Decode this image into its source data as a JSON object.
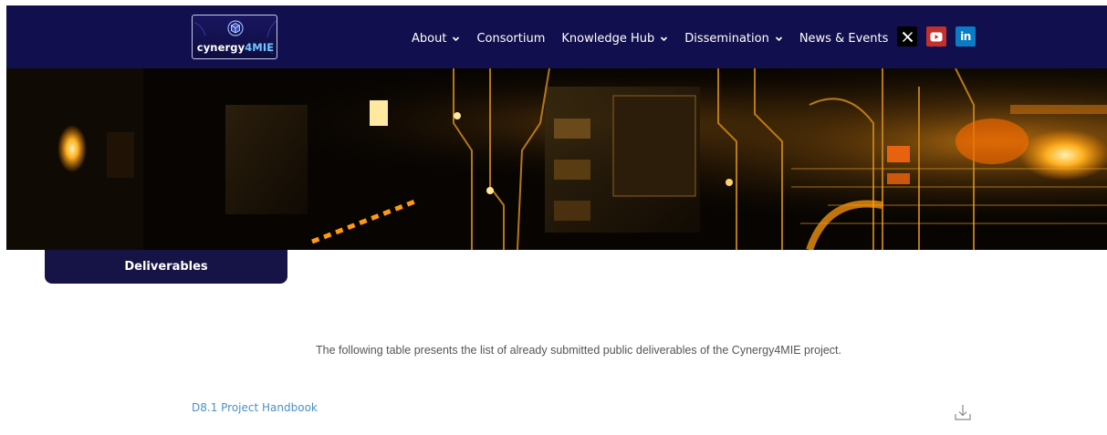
{
  "logo": {
    "text_main": "cynergy",
    "text_accent": "4MIE"
  },
  "nav": {
    "items": [
      {
        "label": "About",
        "has_dropdown": true
      },
      {
        "label": "Consortium",
        "has_dropdown": false
      },
      {
        "label": "Knowledge Hub",
        "has_dropdown": true
      },
      {
        "label": "Dissemination",
        "has_dropdown": true
      },
      {
        "label": "News & Events",
        "has_dropdown": false
      }
    ]
  },
  "social": {
    "x_icon": "x-icon",
    "youtube_icon": "youtube-icon",
    "linkedin_icon": "linkedin-icon",
    "linkedin_glyph": "in"
  },
  "colors": {
    "navbar": "#110f4d",
    "tab": "#161447",
    "link": "#4a90c7",
    "youtube": "#c4302b",
    "linkedin": "#0a7bc4"
  },
  "section_tab": {
    "label": "Deliverables"
  },
  "intro_text": "The following table presents the list of already submitted public deliverables of the Cynergy4MIE project.",
  "deliverables": [
    {
      "title": "D8.1 Project Handbook",
      "icon": "download-icon"
    }
  ]
}
